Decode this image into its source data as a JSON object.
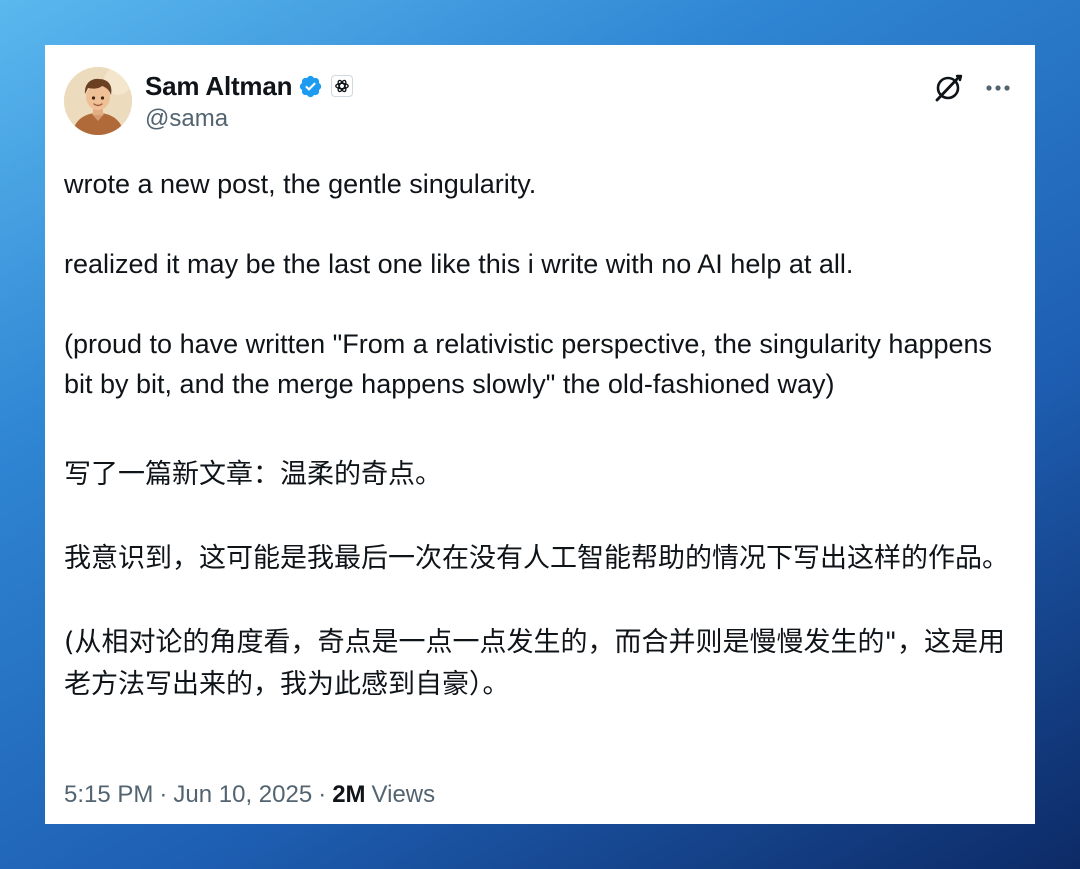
{
  "tweet": {
    "display_name": "Sam Altman",
    "handle": "@sama",
    "icons": {
      "verified": "verified-badge-icon",
      "affiliation": "openai-logo-icon",
      "grok": "grok-icon",
      "more": "more-icon"
    },
    "colors": {
      "verified_blue": "#1d9bf0",
      "text": "#0f1419",
      "muted": "#536471"
    },
    "paragraphs_en": [
      "wrote a new post, the gentle singularity.",
      "realized it may be the last one like this i write with no AI help at all.",
      "(proud to have written \"From a relativistic perspective, the singularity happens bit by bit, and the merge happens slowly\" the old-fashioned way)"
    ],
    "paragraphs_zh": [
      "写了一篇新文章：温柔的奇点。",
      "我意识到，这可能是我最后一次在没有人工智能帮助的情况下写出这样的作品。",
      "(从相对论的角度看，奇点是一点一点发生的，而合并则是慢慢发生的\"，这是用老方法写出来的，我为此感到自豪）。"
    ],
    "time": "5:15 PM",
    "date": "Jun 10, 2025",
    "views_count": "2M",
    "views_label": "Views",
    "separator": "·"
  }
}
